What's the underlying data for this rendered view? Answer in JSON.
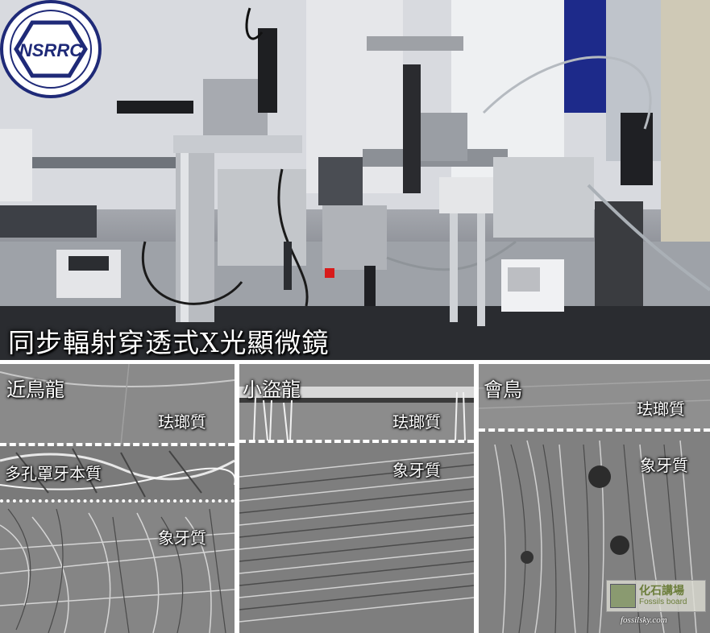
{
  "top": {
    "caption": "同步輻射穿透式X光顯微鏡",
    "logo_text": "NSRRC"
  },
  "panels": [
    {
      "title": "近鳥龍",
      "labels": [
        "珐瑯質",
        "多孔罩牙本質",
        "象牙質"
      ]
    },
    {
      "title": "小盜龍",
      "labels": [
        "珐瑯質",
        "象牙質"
      ]
    },
    {
      "title": "會鳥",
      "labels": [
        "珐瑯質",
        "象牙質"
      ]
    }
  ],
  "watermark": {
    "cn": "化石講場",
    "en": "Fossils board",
    "site": "fossilsky.com"
  },
  "colors": {
    "logo_navy": "#1f2a78",
    "label_white": "#ffffff"
  }
}
